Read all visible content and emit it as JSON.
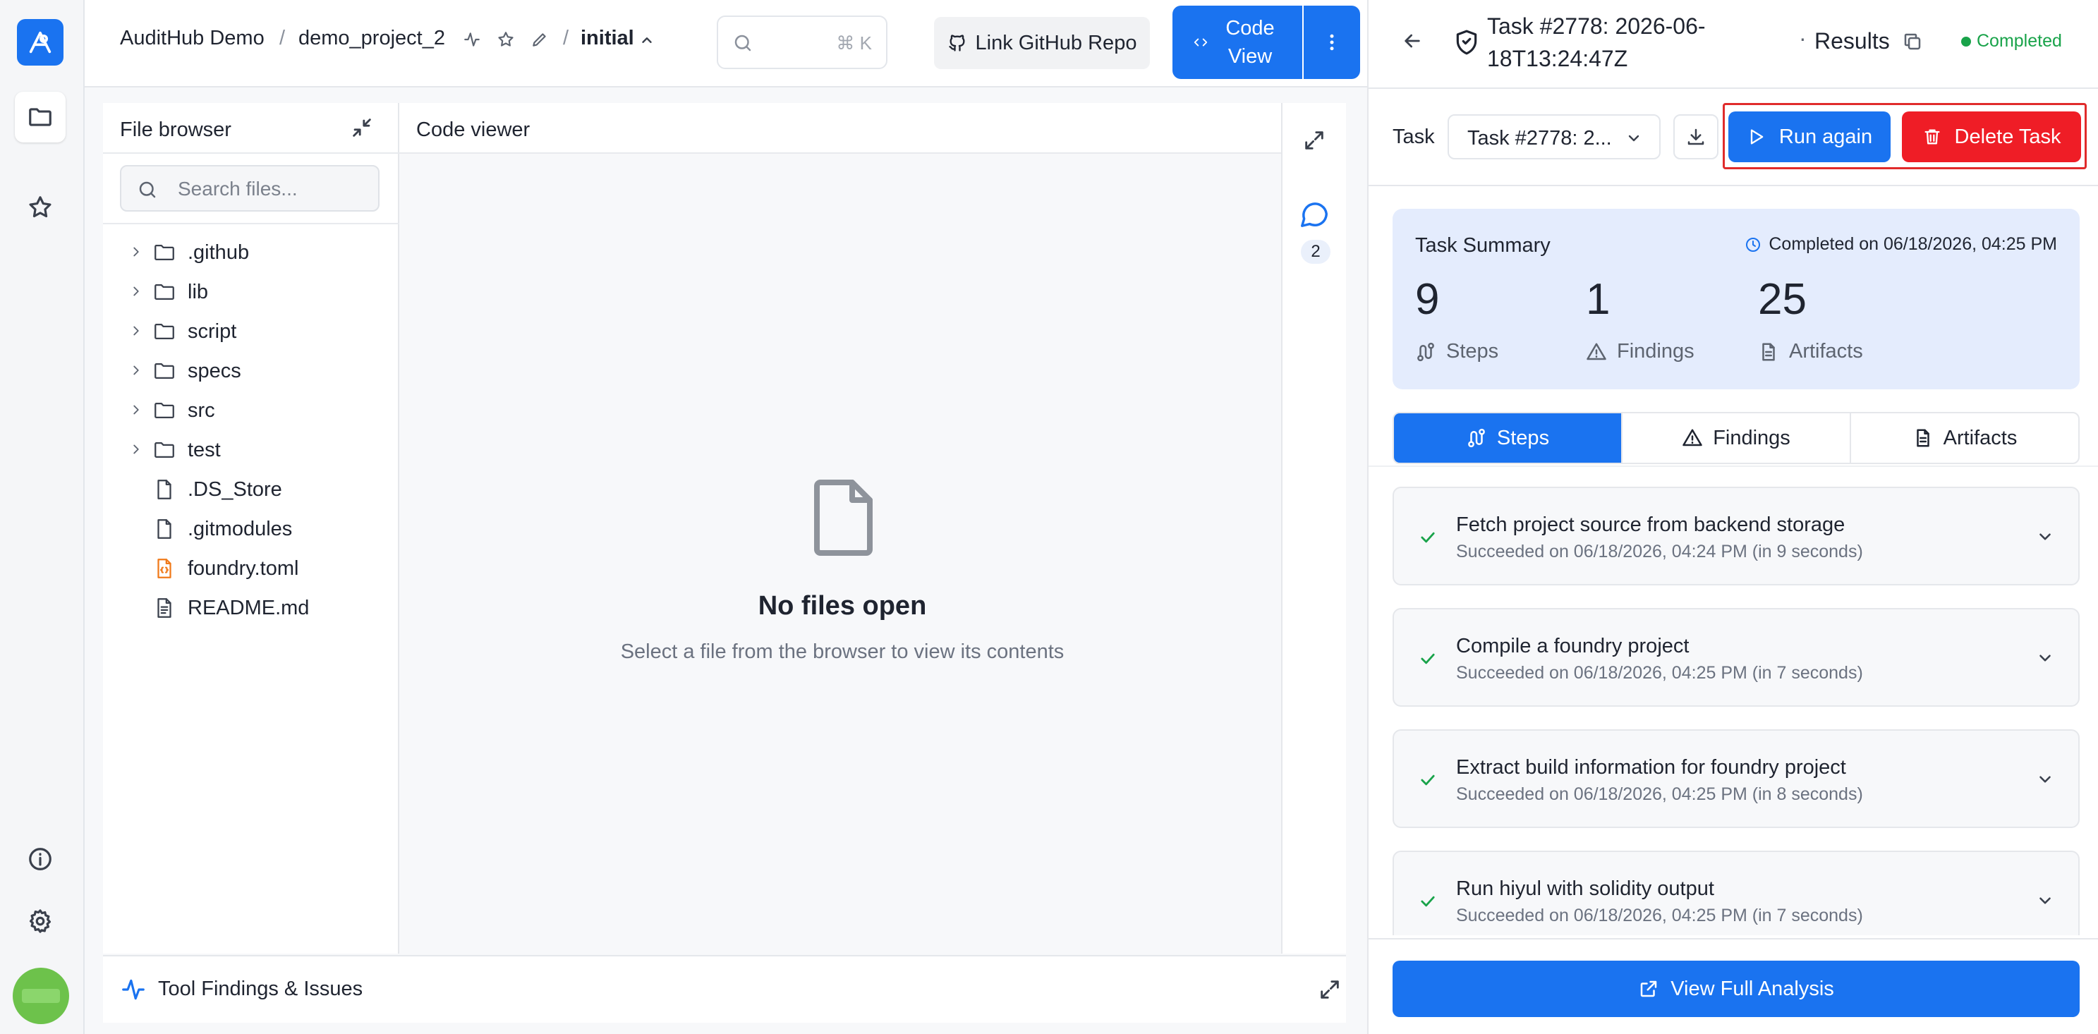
{
  "topbar": {
    "org": "AuditHub Demo",
    "separator": "/",
    "project": "demo_project_2",
    "branch": "initial",
    "search_shortcut": "⌘ K",
    "github_button": "Link GitHub Repo",
    "code_view_button": "Code View"
  },
  "file_browser": {
    "title": "File browser",
    "search_placeholder": "Search files...",
    "items": [
      {
        "name": ".github",
        "type": "folder"
      },
      {
        "name": "lib",
        "type": "folder"
      },
      {
        "name": "script",
        "type": "folder"
      },
      {
        "name": "specs",
        "type": "folder"
      },
      {
        "name": "src",
        "type": "folder"
      },
      {
        "name": "test",
        "type": "folder"
      },
      {
        "name": ".DS_Store",
        "type": "file"
      },
      {
        "name": ".gitmodules",
        "type": "file"
      },
      {
        "name": "foundry.toml",
        "type": "config-file"
      },
      {
        "name": "README.md",
        "type": "text-file"
      }
    ]
  },
  "code_viewer": {
    "title": "Code viewer",
    "empty_title": "No files open",
    "empty_subtitle": "Select a file from the browser to view its contents"
  },
  "side_column": {
    "comment_count": "2"
  },
  "tool_findings": {
    "title": "Tool Findings & Issues"
  },
  "panel": {
    "title": "Task #2778: 2026-06-18T13:24:47Z",
    "dot": "·",
    "results": "Results",
    "status": "Completed",
    "task_label": "Task",
    "task_select_value": "Task #2778: 2...",
    "run_again": "Run again",
    "delete_task": "Delete Task",
    "summary": {
      "title": "Task Summary",
      "completed_on": "Completed on 06/18/2026, 04:25 PM",
      "stats": [
        {
          "value": "9",
          "label": "Steps"
        },
        {
          "value": "1",
          "label": "Findings"
        },
        {
          "value": "25",
          "label": "Artifacts"
        }
      ]
    },
    "tabs": [
      {
        "label": "Steps",
        "active": true
      },
      {
        "label": "Findings",
        "active": false
      },
      {
        "label": "Artifacts",
        "active": false
      }
    ],
    "steps": [
      {
        "title": "Fetch project source from backend storage",
        "status": "Succeeded on 06/18/2026, 04:24 PM (in 9 seconds)"
      },
      {
        "title": "Compile a foundry project",
        "status": "Succeeded on 06/18/2026, 04:25 PM (in 7 seconds)"
      },
      {
        "title": "Extract build information for foundry project",
        "status": "Succeeded on 06/18/2026, 04:25 PM (in 8 seconds)"
      },
      {
        "title": "Run hiyul with solidity output",
        "status": "Succeeded on 06/18/2026, 04:25 PM (in 7 seconds)"
      }
    ],
    "view_full_analysis": "View Full Analysis"
  },
  "colors": {
    "accent": "#1a73f0",
    "danger": "#ef1d26",
    "success": "#19a34a",
    "summary_bg": "#e4ecfd",
    "highlight_border": "#e02b2b"
  }
}
